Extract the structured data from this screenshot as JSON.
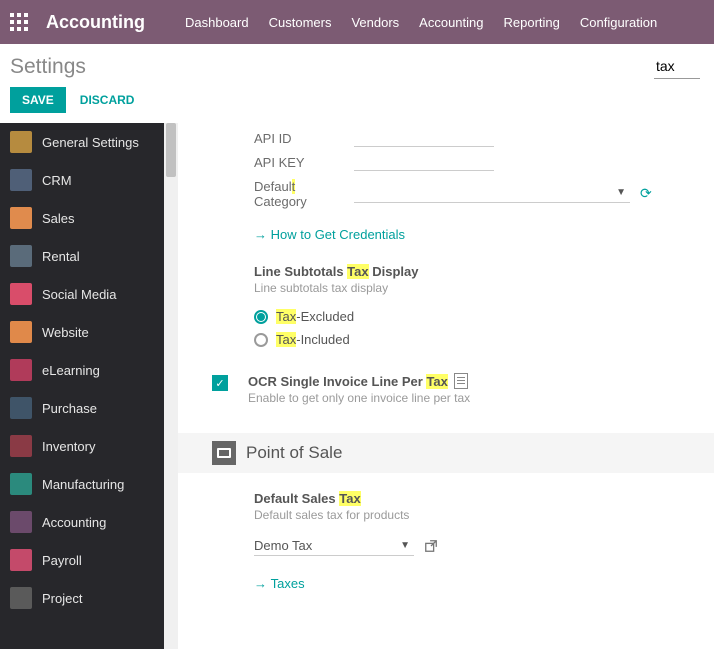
{
  "topbar": {
    "brand": "Accounting",
    "nav": [
      "Dashboard",
      "Customers",
      "Vendors",
      "Accounting",
      "Reporting",
      "Configuration"
    ]
  },
  "subhead": {
    "title": "Settings",
    "search_value": "tax"
  },
  "actions": {
    "save": "SAVE",
    "discard": "DISCARD"
  },
  "sidebar": [
    {
      "label": "General Settings",
      "bg": "#b68b3f"
    },
    {
      "label": "CRM",
      "bg": "#4f5f77"
    },
    {
      "label": "Sales",
      "bg": "#e08b4d"
    },
    {
      "label": "Rental",
      "bg": "#5a6b7a"
    },
    {
      "label": "Social Media",
      "bg": "#d94d6a"
    },
    {
      "label": "Website",
      "bg": "#e0894a"
    },
    {
      "label": "eLearning",
      "bg": "#b03b5a"
    },
    {
      "label": "Purchase",
      "bg": "#3f5468"
    },
    {
      "label": "Inventory",
      "bg": "#8a3a45"
    },
    {
      "label": "Manufacturing",
      "bg": "#2b8a7d"
    },
    {
      "label": "Accounting",
      "bg": "#6b4a6b"
    },
    {
      "label": "Payroll",
      "bg": "#c44a6a"
    },
    {
      "label": "Project",
      "bg": "#5a5a5a"
    }
  ],
  "form": {
    "api_id_label": "API ID",
    "api_key_label": "API KEY",
    "default_cat_label_1": "Defaul",
    "default_cat_label_hl": "t",
    "default_cat_label_2": "Category",
    "how_link": "How to Get Credentials",
    "subtotal_title_pre": "Line Subtotals ",
    "subtotal_title_hl": "Tax",
    "subtotal_title_post": " Display",
    "subtotal_sub": "Line subtotals tax display",
    "radio_excl_hl": "Tax",
    "radio_excl_post": "-Excluded",
    "radio_incl_hl": "Tax",
    "radio_incl_post": "-Included",
    "ocr_title_pre": "OCR Single Invoice Line Per ",
    "ocr_title_hl": "Tax",
    "ocr_sub": "Enable to get only one invoice line per tax",
    "pos_header": "Point of Sale",
    "dst_title_pre": "Default Sales ",
    "dst_title_hl": "Tax",
    "dst_sub": "Default sales tax for products",
    "demo_tax": "Demo Tax",
    "taxes_link": "Taxes"
  }
}
